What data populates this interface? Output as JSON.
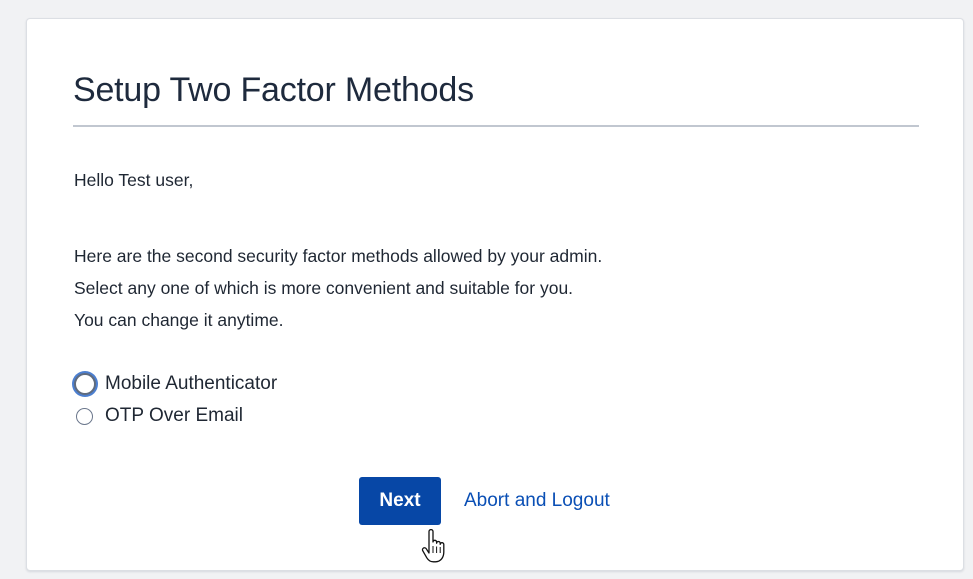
{
  "page": {
    "title": "Setup Two Factor Methods",
    "greeting": "Hello Test user,",
    "intro_lines": [
      "Here are the second security factor methods allowed by your admin.",
      "Select any one of which is more convenient and suitable for you.",
      "You can change it anytime."
    ]
  },
  "methods": [
    {
      "label": "Mobile Authenticator",
      "selected": false,
      "focused": true
    },
    {
      "label": "OTP Over Email",
      "selected": false,
      "focused": false
    }
  ],
  "actions": {
    "next_label": "Next",
    "abort_label": "Abort and Logout"
  },
  "colors": {
    "primary_button": "#0747a6",
    "link": "#0a4fb5",
    "focus_ring": "#4c7fd0"
  },
  "icons": {
    "cursor": "hand-pointer-icon"
  }
}
